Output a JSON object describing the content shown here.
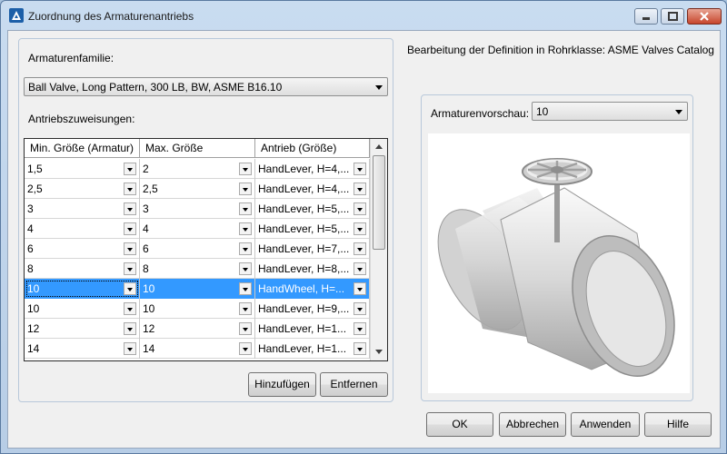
{
  "window": {
    "title": "Zuordnung des Armaturenantriebs"
  },
  "left": {
    "family_label": "Armaturenfamilie:",
    "family_value": "Ball Valve, Long Pattern, 300 LB, BW, ASME B16.10",
    "assign_label": "Antriebszuweisungen:",
    "columns": [
      "Min. Größe (Armatur)",
      "Max. Größe",
      "Antrieb (Größe)"
    ],
    "rows": [
      {
        "min": "1,5",
        "max": "2",
        "drive": "HandLever, H=4,..."
      },
      {
        "min": "2,5",
        "max": "2,5",
        "drive": "HandLever, H=4,..."
      },
      {
        "min": "3",
        "max": "3",
        "drive": "HandLever, H=5,..."
      },
      {
        "min": "4",
        "max": "4",
        "drive": "HandLever, H=5,..."
      },
      {
        "min": "6",
        "max": "6",
        "drive": "HandLever, H=7,..."
      },
      {
        "min": "8",
        "max": "8",
        "drive": "HandLever, H=8,..."
      },
      {
        "min": "10",
        "max": "10",
        "drive": "HandWheel, H=..."
      },
      {
        "min": "10",
        "max": "10",
        "drive": "HandLever, H=9,..."
      },
      {
        "min": "12",
        "max": "12",
        "drive": "HandLever, H=1..."
      },
      {
        "min": "14",
        "max": "14",
        "drive": "HandLever, H=1..."
      }
    ],
    "selected_row": 6,
    "add_label": "Hinzufügen",
    "remove_label": "Entfernen"
  },
  "right": {
    "heading": "Bearbeitung der Definition in Rohrklasse: ASME Valves Catalog",
    "preview_label": "Armaturenvorschau:",
    "preview_value": "10"
  },
  "footer": {
    "ok": "OK",
    "cancel": "Abbrechen",
    "apply": "Anwenden",
    "help": "Hilfe"
  },
  "colors": {
    "selection": "#3399ff",
    "title_bar": "#b7cde6"
  },
  "icons": [
    "app-icon",
    "minimize-icon",
    "maximize-icon",
    "close-icon",
    "dropdown-arrow-icon",
    "scroll-up-icon",
    "scroll-down-icon"
  ]
}
